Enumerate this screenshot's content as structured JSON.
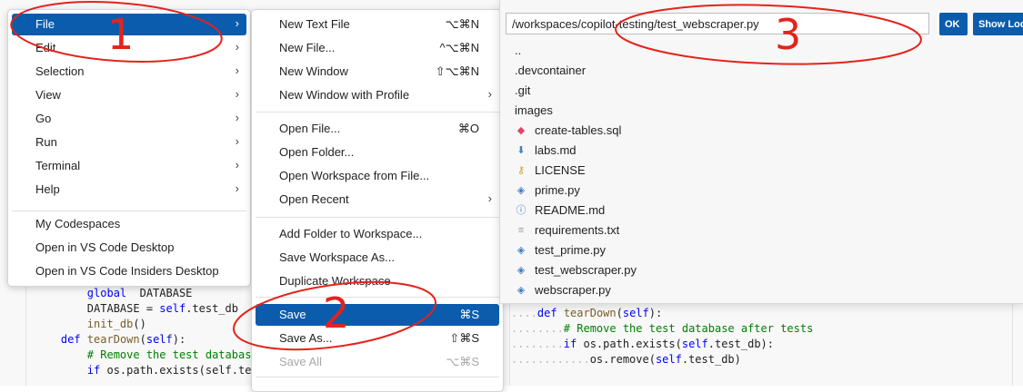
{
  "editor": {
    "left_lines": [
      {
        "indent": "        ",
        "parts": [
          [
            "kw",
            "global"
          ],
          [
            "",
            "  DATABASE"
          ]
        ]
      },
      {
        "indent": "        ",
        "parts": [
          [
            "",
            "DATABASE = "
          ],
          [
            "kw",
            "self"
          ],
          [
            "",
            ".test_db"
          ]
        ]
      },
      {
        "indent": "        ",
        "parts": [
          [
            "fn",
            "init_db"
          ],
          [
            "",
            "()"
          ]
        ]
      },
      {
        "indent": "",
        "parts": [
          [
            "",
            ""
          ]
        ]
      },
      {
        "indent": "    ",
        "parts": [
          [
            "kw",
            "def"
          ],
          [
            "",
            ""
          ],
          [
            "fn",
            " tearDown"
          ],
          [
            "",
            "("
          ],
          [
            "kw",
            "self"
          ],
          [
            "",
            "):"
          ]
        ]
      },
      {
        "indent": "        ",
        "parts": [
          [
            "cm",
            "# Remove the test databas"
          ]
        ]
      },
      {
        "indent": "        ",
        "parts": [
          [
            "kw",
            "if"
          ],
          [
            "",
            " os.path.exists(self.te"
          ]
        ]
      }
    ],
    "right_lines": [
      {
        "guide": "....",
        "parts": [
          [
            "kw",
            "def"
          ],
          [
            "fn",
            " tearDown"
          ],
          [
            "",
            "("
          ],
          [
            "kw",
            "self"
          ],
          [
            "",
            "):"
          ]
        ]
      },
      {
        "guide": "........",
        "parts": [
          [
            "cm",
            "# Remove the test database after tests"
          ]
        ]
      },
      {
        "guide": "........",
        "parts": [
          [
            "kw",
            "if"
          ],
          [
            "",
            " os.path.exists("
          ],
          [
            "kw",
            "self"
          ],
          [
            "",
            ".test_db):"
          ]
        ]
      },
      {
        "guide": "............",
        "parts": [
          [
            "",
            "os.remove("
          ],
          [
            "kw",
            "self"
          ],
          [
            "",
            ".test_db)"
          ]
        ]
      }
    ]
  },
  "main_menu": {
    "items": [
      {
        "label": "File",
        "has_sub": true,
        "active": true
      },
      {
        "label": "Edit",
        "has_sub": true
      },
      {
        "label": "Selection",
        "has_sub": true
      },
      {
        "label": "View",
        "has_sub": true
      },
      {
        "label": "Go",
        "has_sub": true
      },
      {
        "label": "Run",
        "has_sub": true
      },
      {
        "label": "Terminal",
        "has_sub": true
      },
      {
        "label": "Help",
        "has_sub": true
      }
    ],
    "extra": [
      "My Codespaces",
      "Open in VS Code Desktop",
      "Open in VS Code Insiders Desktop"
    ]
  },
  "file_menu": {
    "group1": [
      {
        "label": "New Text File",
        "kb": "⌥⌘N"
      },
      {
        "label": "New File...",
        "kb": "^⌥⌘N"
      },
      {
        "label": "New Window",
        "kb": "⇧⌥⌘N"
      },
      {
        "label": "New Window with Profile",
        "kb": "",
        "has_sub": true
      }
    ],
    "group2": [
      {
        "label": "Open File...",
        "kb": "⌘O"
      },
      {
        "label": "Open Folder...",
        "kb": ""
      },
      {
        "label": "Open Workspace from File...",
        "kb": ""
      },
      {
        "label": "Open Recent",
        "kb": "",
        "has_sub": true
      }
    ],
    "group3": [
      {
        "label": "Add Folder to Workspace...",
        "kb": ""
      },
      {
        "label": "Save Workspace As...",
        "kb": ""
      },
      {
        "label": "Duplicate Workspace",
        "kb": ""
      }
    ],
    "group4": [
      {
        "label": "Save",
        "kb": "⌘S",
        "active": true
      },
      {
        "label": "Save As...",
        "kb": "⇧⌘S"
      },
      {
        "label": "Save All",
        "kb": "⌥⌘S",
        "disabled": true
      }
    ]
  },
  "dialog": {
    "path_value": "/workspaces/copilot-testing/test_webscraper.py",
    "ok_label": "OK",
    "show_local_label": "Show Local",
    "entries": [
      {
        "name": "..",
        "icon": "none"
      },
      {
        "name": ".devcontainer",
        "icon": "none"
      },
      {
        "name": ".git",
        "icon": "none"
      },
      {
        "name": "images",
        "icon": "none"
      },
      {
        "name": "create-tables.sql",
        "icon": "database-icon",
        "color": "#e0456b"
      },
      {
        "name": "labs.md",
        "icon": "markdown-icon",
        "color": "#4a7fb5"
      },
      {
        "name": "LICENSE",
        "icon": "license-icon",
        "color": "#c9a227"
      },
      {
        "name": "prime.py",
        "icon": "python-icon",
        "color": "#3f7cc0"
      },
      {
        "name": "README.md",
        "icon": "info-icon",
        "color": "#3f7cc0"
      },
      {
        "name": "requirements.txt",
        "icon": "text-file-icon",
        "color": "#9a9a9a"
      },
      {
        "name": "test_prime.py",
        "icon": "python-icon",
        "color": "#3f7cc0"
      },
      {
        "name": "test_webscraper.py",
        "icon": "python-icon",
        "color": "#3f7cc0"
      },
      {
        "name": "webscraper.py",
        "icon": "python-icon",
        "color": "#3f7cc0"
      }
    ]
  },
  "annotations": {
    "step1": "1",
    "step2": "2",
    "step3": "3",
    "color": "#e3231b"
  },
  "colors": {
    "accent": "#0b5cad"
  }
}
